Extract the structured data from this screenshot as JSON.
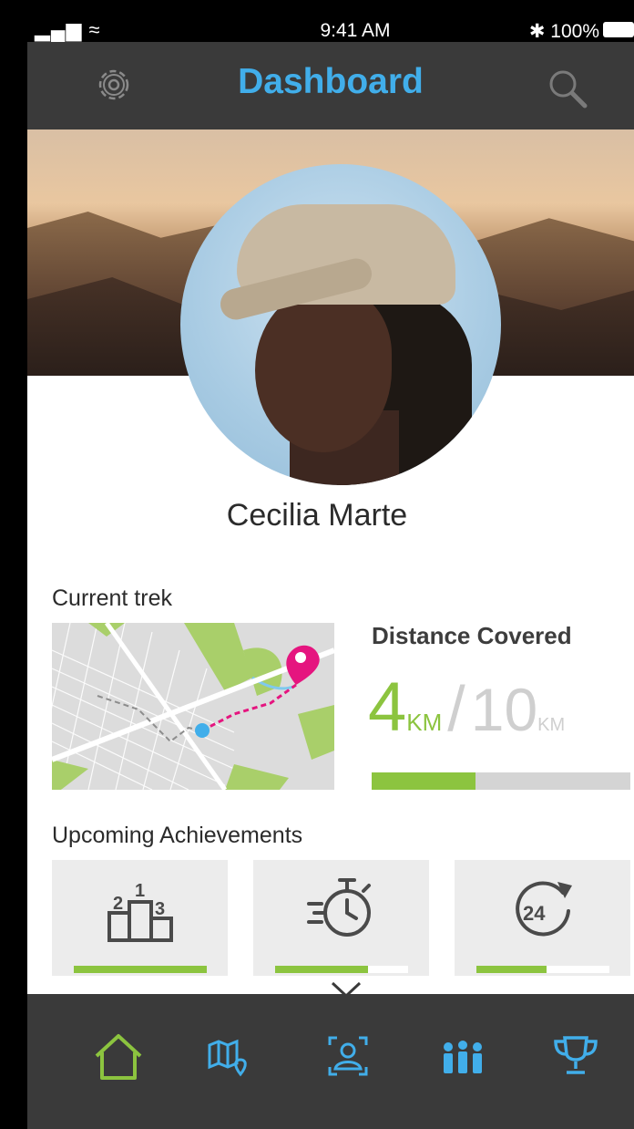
{
  "status_bar": {
    "signal": "▂▄▆ ≈",
    "time": "9:41 AM",
    "battery": "✱ 100%"
  },
  "header": {
    "title": "Dashboard",
    "settings_icon": "gear-icon",
    "search_icon": "search-icon"
  },
  "profile": {
    "name": "Cecilia Marte"
  },
  "current_trek": {
    "label": "Current trek",
    "distance_title": "Distance Covered",
    "covered_value": "4",
    "covered_unit": "KM",
    "separator": "/",
    "total_value": "10",
    "total_unit": "KM",
    "progress_fraction": 0.4
  },
  "achievements": {
    "label": "Upcoming Achievements",
    "cards": [
      {
        "icon": "podium-icon",
        "progress_fraction": 1.0
      },
      {
        "icon": "stopwatch-speed-icon",
        "progress_fraction": 0.7
      },
      {
        "icon": "24-hour-icon",
        "progress_fraction": 0.53
      }
    ]
  },
  "nav": {
    "items": [
      {
        "icon": "home-icon",
        "active": true
      },
      {
        "icon": "map-icon",
        "active": false
      },
      {
        "icon": "scan-profile-icon",
        "active": false
      },
      {
        "icon": "group-icon",
        "active": false
      },
      {
        "icon": "trophy-icon",
        "active": false
      }
    ]
  },
  "colors": {
    "accent_blue": "#41aeea",
    "accent_green": "#8cc43f",
    "header_bg": "#3a3a3a",
    "map_pin": "#e5157f"
  }
}
